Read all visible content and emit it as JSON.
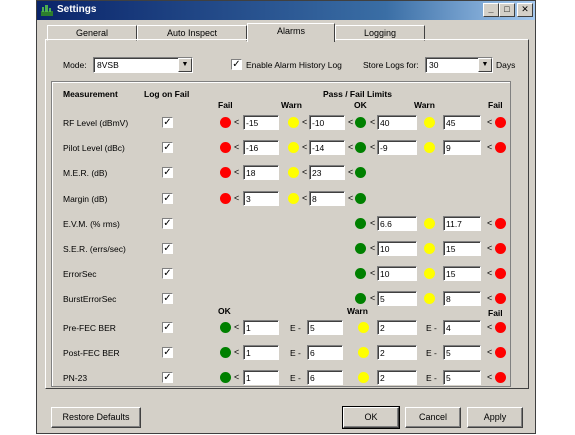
{
  "window": {
    "title": "Settings",
    "minimize": "_",
    "maximize": "□",
    "close": "✕"
  },
  "tabs": [
    "General",
    "Auto Inspect",
    "Alarms",
    "Logging"
  ],
  "mode": {
    "label": "Mode:",
    "value": "8VSB"
  },
  "alarm_history": {
    "label": "Enable Alarm History Log",
    "checked": true
  },
  "store_logs": {
    "label": "Store Logs for:",
    "value": "30",
    "unit": "Days"
  },
  "headers": {
    "measurement": "Measurement",
    "log_on_fail": "Log on Fail",
    "limits": "Pass / Fail Limits",
    "fail": "Fail",
    "warn": "Warn",
    "ok": "OK"
  },
  "rows": [
    {
      "name": "RF Level (dBmV)",
      "f1": "-15",
      "w1": "-10",
      "w2": "40",
      "f2": "45"
    },
    {
      "name": "Pilot Level (dBc)",
      "f1": "-16",
      "w1": "-14",
      "w2": "-9",
      "f2": "9"
    },
    {
      "name": "M.E.R. (dB)",
      "f1": "18",
      "w1": "23"
    },
    {
      "name": "Margin (dB)",
      "f1": "3",
      "w1": "8"
    },
    {
      "name": "E.V.M. (% rms)",
      "w2": "6.6",
      "f2": "11.7"
    },
    {
      "name": "S.E.R. (errs/sec)",
      "w2": "10",
      "f2": "15"
    },
    {
      "name": "ErrorSec",
      "w2": "10",
      "f2": "15"
    },
    {
      "name": "BurstErrorSec",
      "w2": "5",
      "f2": "8"
    }
  ],
  "ber_headers": {
    "ok": "OK",
    "warn": "Warn",
    "fail": "Fail"
  },
  "ber_rows": [
    {
      "name": "Pre-FEC BER",
      "ok_m": "1",
      "ok_e": "5",
      "fail_m": "2",
      "fail_e": "4"
    },
    {
      "name": "Post-FEC BER",
      "ok_m": "1",
      "ok_e": "6",
      "fail_m": "2",
      "fail_e": "5"
    },
    {
      "name": "PN-23",
      "ok_m": "1",
      "ok_e": "6",
      "fail_m": "2",
      "fail_e": "5"
    }
  ],
  "exp_label": "E -",
  "lt": "<",
  "check_mark": "✓",
  "buttons": {
    "restore": "Restore Defaults",
    "ok": "OK",
    "cancel": "Cancel",
    "apply": "Apply"
  }
}
